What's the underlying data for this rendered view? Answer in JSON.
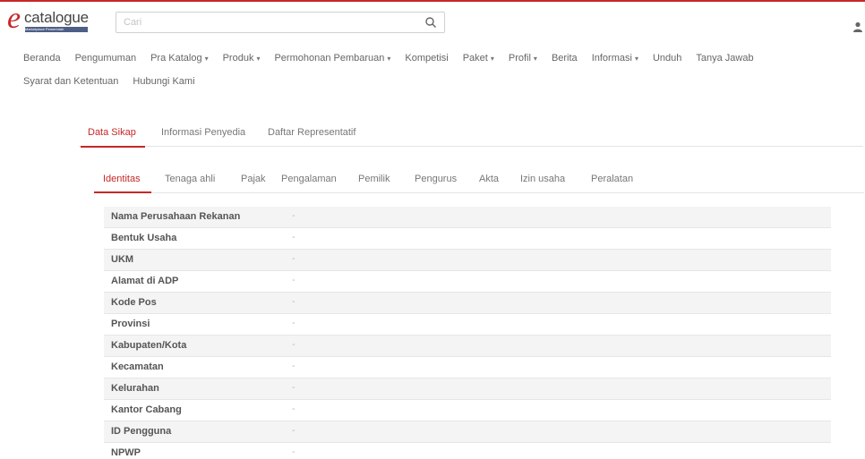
{
  "header": {
    "logo_letter": "e",
    "logo_word": "catalogue",
    "logo_tagline": "Marketplace Pemerintah",
    "search_placeholder": "Cari"
  },
  "nav": {
    "row1": [
      {
        "label": "Beranda",
        "dropdown": false
      },
      {
        "label": "Pengumuman",
        "dropdown": false
      },
      {
        "label": "Pra Katalog",
        "dropdown": true
      },
      {
        "label": "Produk",
        "dropdown": true
      },
      {
        "label": "Permohonan Pembaruan",
        "dropdown": true
      },
      {
        "label": "Kompetisi",
        "dropdown": false
      },
      {
        "label": "Paket",
        "dropdown": true
      },
      {
        "label": "Profil",
        "dropdown": true
      },
      {
        "label": "Berita",
        "dropdown": false
      },
      {
        "label": "Informasi",
        "dropdown": true
      },
      {
        "label": "Unduh",
        "dropdown": false
      },
      {
        "label": "Tanya Jawab",
        "dropdown": false
      }
    ],
    "row2": [
      {
        "label": "Syarat dan Ketentuan",
        "dropdown": false
      },
      {
        "label": "Hubungi Kami",
        "dropdown": false
      }
    ],
    "caret": "▾"
  },
  "tabs_main": [
    "Data Sikap",
    "Informasi Penyedia",
    "Daftar Representatif"
  ],
  "tabs_sub": [
    "Identitas",
    "Tenaga ahli",
    "Pajak",
    "Pengalaman",
    "Pemilik",
    "Pengurus",
    "Akta",
    "Izin usaha",
    "Peralatan"
  ],
  "identity_rows": [
    {
      "label": "Nama Perusahaan Rekanan",
      "value": "-"
    },
    {
      "label": "Bentuk Usaha",
      "value": "-"
    },
    {
      "label": "UKM",
      "value": "-"
    },
    {
      "label": "Alamat di ADP",
      "value": "-"
    },
    {
      "label": "Kode Pos",
      "value": "-"
    },
    {
      "label": "Provinsi",
      "value": "-"
    },
    {
      "label": "Kabupaten/Kota",
      "value": "-"
    },
    {
      "label": "Kecamatan",
      "value": "-"
    },
    {
      "label": "Kelurahan",
      "value": "-"
    },
    {
      "label": "Kantor Cabang",
      "value": "-"
    },
    {
      "label": "ID Pengguna",
      "value": "-"
    },
    {
      "label": "NPWP",
      "value": "-"
    }
  ],
  "colors": {
    "accent": "#c62828",
    "text": "#555555",
    "row_alt": "#f4f4f4"
  }
}
